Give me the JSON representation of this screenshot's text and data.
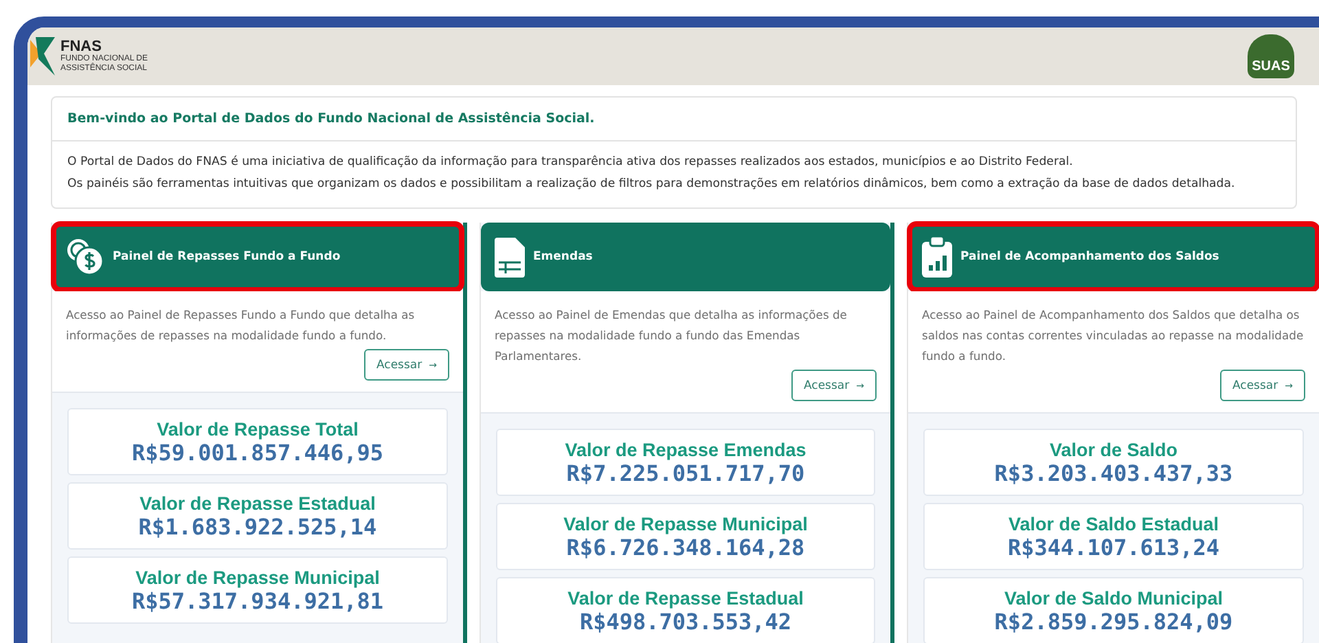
{
  "header": {
    "logo_left": {
      "name": "FNAS",
      "subtitle": "FUNDO NACIONAL DE ASSISTÊNCIA SOCIAL"
    },
    "logo_right": {
      "name": "SUAS"
    }
  },
  "intro": {
    "title": "Bem-vindo ao Portal de Dados do Fundo Nacional de Assistência Social.",
    "paragraphs": [
      "O Portal de Dados do FNAS é uma iniciativa de qualificação da informação para transparência ativa dos repasses realizados aos estados, municípios e ao Distrito Federal.",
      "Os painéis são ferramentas intuitivas que organizam os dados e possibilitam a realização de filtros para demonstrações em relatórios dinâmicos, bem como a extração da base de dados detalhada."
    ]
  },
  "cards": [
    {
      "kind": "coins",
      "title": "Painel de Repasses Fundo a Fundo",
      "highlighted": true,
      "description": "Acesso ao Painel de Repasses Fundo a Fundo que detalha as informações de repasses na modalidade fundo a fundo.",
      "button": "Acessar",
      "arrow": "→",
      "stats": [
        {
          "label": "Valor de Repasse Total",
          "value": "R$59.001.857.446,95"
        },
        {
          "label": "Valor de Repasse Estadual",
          "value": "R$1.683.922.525,14"
        },
        {
          "label": "Valor de Repasse Municipal",
          "value": "R$57.317.934.921,81"
        }
      ]
    },
    {
      "kind": "document",
      "title": "Emendas",
      "highlighted": false,
      "description": "Acesso ao Painel de Emendas que detalha as informações de repasses na modalidade fundo a fundo das Emendas Parlamentares.",
      "button": "Acessar",
      "arrow": "→",
      "stats": [
        {
          "label": "Valor de Repasse Emendas",
          "value": "R$7.225.051.717,70"
        },
        {
          "label": "Valor de Repasse Municipal",
          "value": "R$6.726.348.164,28"
        },
        {
          "label": "Valor de Repasse Estadual",
          "value": "R$498.703.553,42"
        }
      ]
    },
    {
      "kind": "clipboard",
      "title": "Painel de Acompanhamento dos Saldos",
      "highlighted": true,
      "description": "Acesso ao Painel de Acompanhamento dos Saldos que detalha os saldos nas contas correntes vinculadas ao repasse na modalidade fundo a fundo.",
      "button": "Acessar",
      "arrow": "→",
      "stats": [
        {
          "label": "Valor de Saldo",
          "value": "R$3.203.403.437,33"
        },
        {
          "label": "Valor de Saldo Estadual",
          "value": "R$344.107.613,24"
        },
        {
          "label": "Valor de Saldo Municipal",
          "value": "R$2.859.295.824,09"
        }
      ]
    }
  ]
}
